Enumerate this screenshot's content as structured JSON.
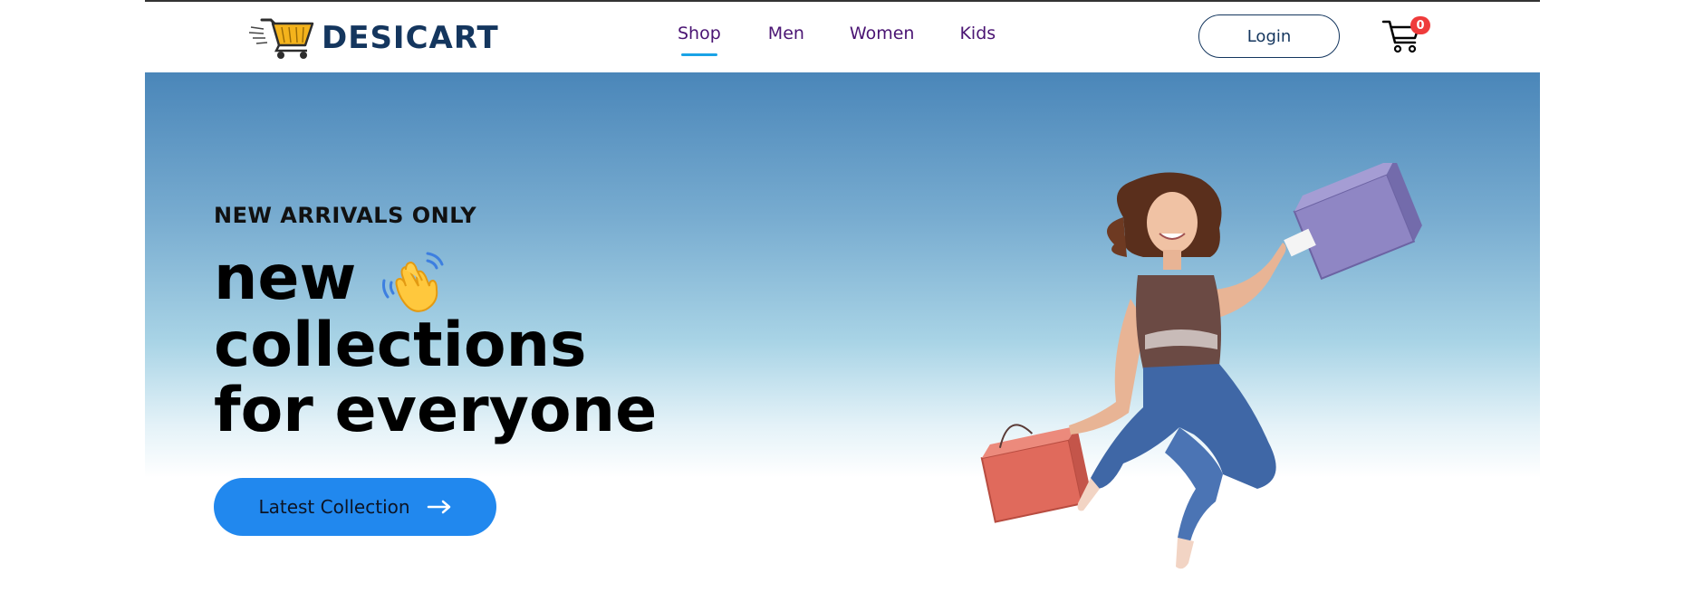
{
  "brand": {
    "name": "DESICART",
    "logo_icon": "shopping-cart-logo-icon",
    "colors": {
      "brand": "#14365e",
      "nav": "#4a1473",
      "accent": "#1aa3e6",
      "cta": "#2188ee",
      "badge": "#ef3b3b"
    }
  },
  "nav": {
    "items": [
      {
        "label": "Shop",
        "active": true
      },
      {
        "label": "Men",
        "active": false
      },
      {
        "label": "Women",
        "active": false
      },
      {
        "label": "Kids",
        "active": false
      }
    ],
    "login_label": "Login",
    "cart_icon": "cart-icon",
    "cart_count": "0"
  },
  "hero": {
    "kicker": "NEW ARRIVALS ONLY",
    "line1": "new",
    "line2": "collections",
    "line3": "for everyone",
    "wave_icon": "waving-hand-icon",
    "cta_label": "Latest Collection",
    "cta_icon": "arrow-right-icon",
    "image": "jumping-woman-with-shopping-bags"
  }
}
